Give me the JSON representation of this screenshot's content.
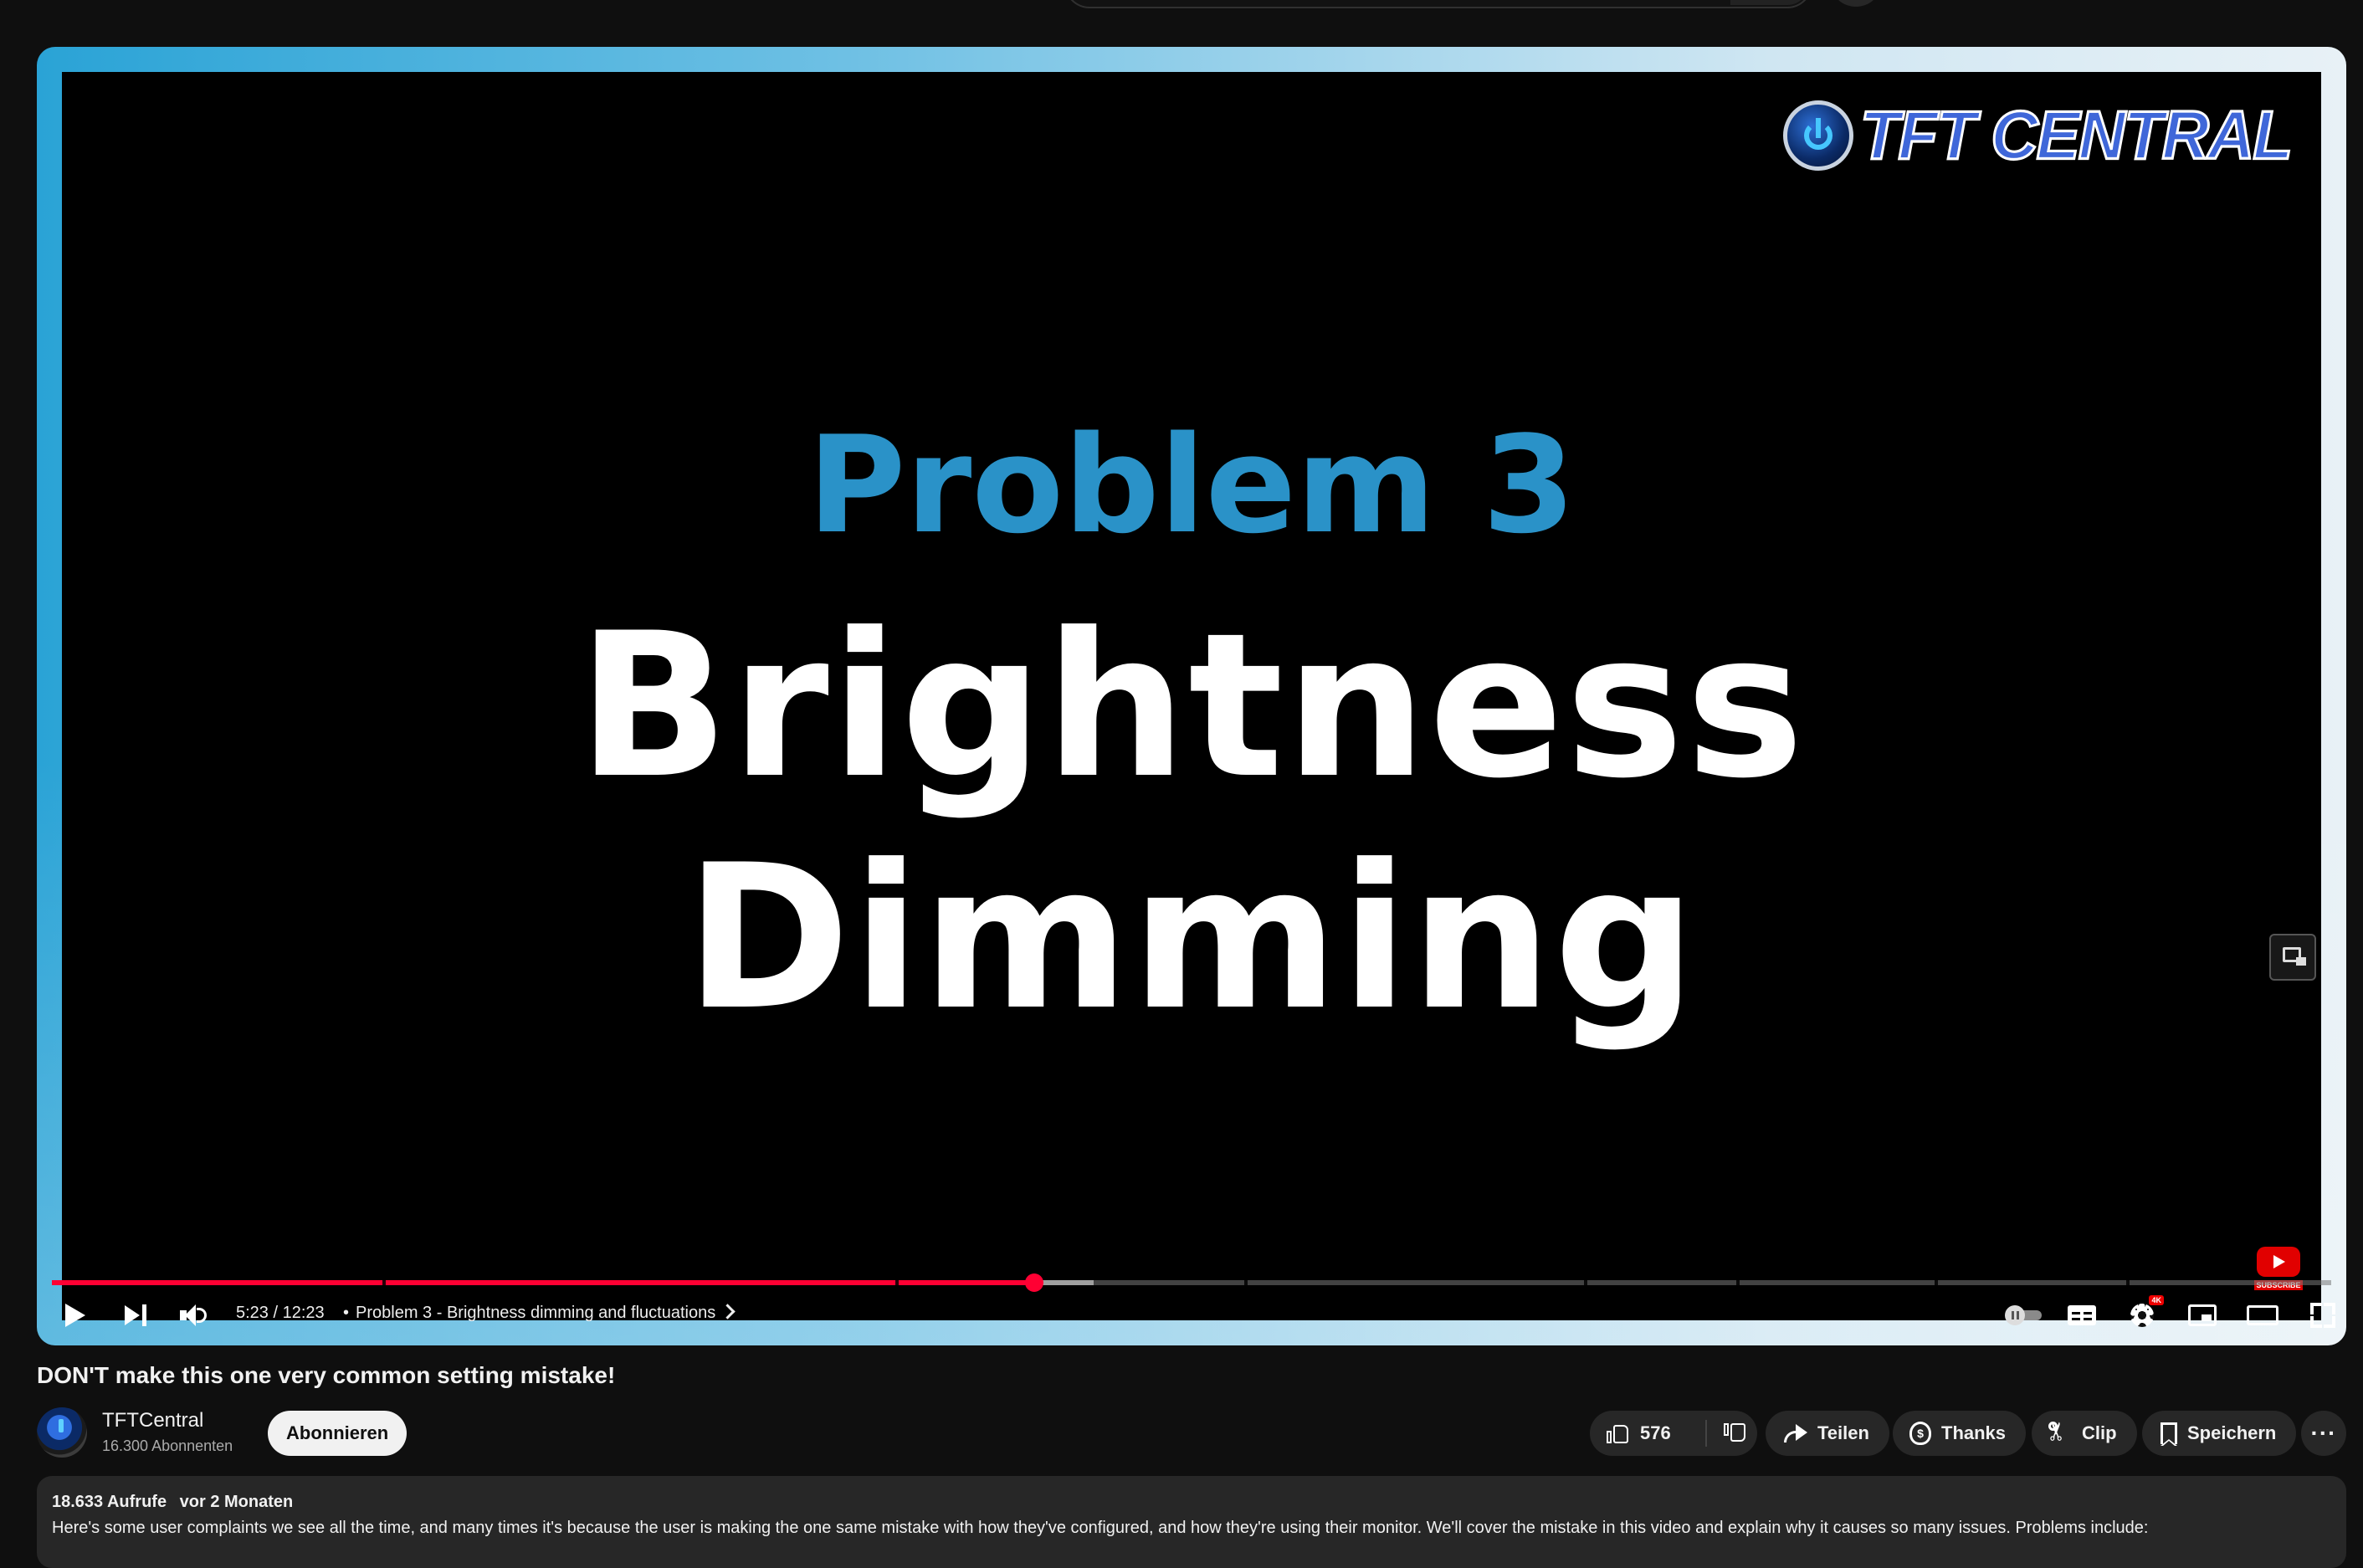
{
  "player": {
    "brand_logo_text": "TFT CENTRAL",
    "slide_heading": "Problem 3",
    "slide_subheading": "Brightness Dimming",
    "time_display": "5:23 / 12:23",
    "chapter_title": "Problem 3 - Brightness dimming and fluctuations",
    "played_fraction": 0.431,
    "buffered_fraction": 0.457,
    "chapter_marks": [
      0.145,
      0.37,
      0.523,
      0.672,
      0.739,
      0.826,
      0.91
    ],
    "settings_badge": "4K",
    "watermark_label": "SUBSCRIBE",
    "accent_color": "#ff0033"
  },
  "video": {
    "title": "DON'T make this one very common setting mistake!"
  },
  "channel": {
    "name": "TFTCentral",
    "subscribers": "16.300 Abonnenten",
    "subscribe_label": "Abonnieren"
  },
  "actions": {
    "like_count": "576",
    "share_label": "Teilen",
    "thanks_label": "Thanks",
    "clip_label": "Clip",
    "save_label": "Speichern",
    "more_label": "···"
  },
  "description": {
    "views": "18.633 Aufrufe",
    "age": "vor 2 Monaten",
    "text": "Here's some user complaints we see all the time, and many times it's because the user is making the one same mistake with how they've configured, and how they're using their monitor. We'll cover the mistake in this video and explain why it causes so many issues. Problems include:"
  }
}
